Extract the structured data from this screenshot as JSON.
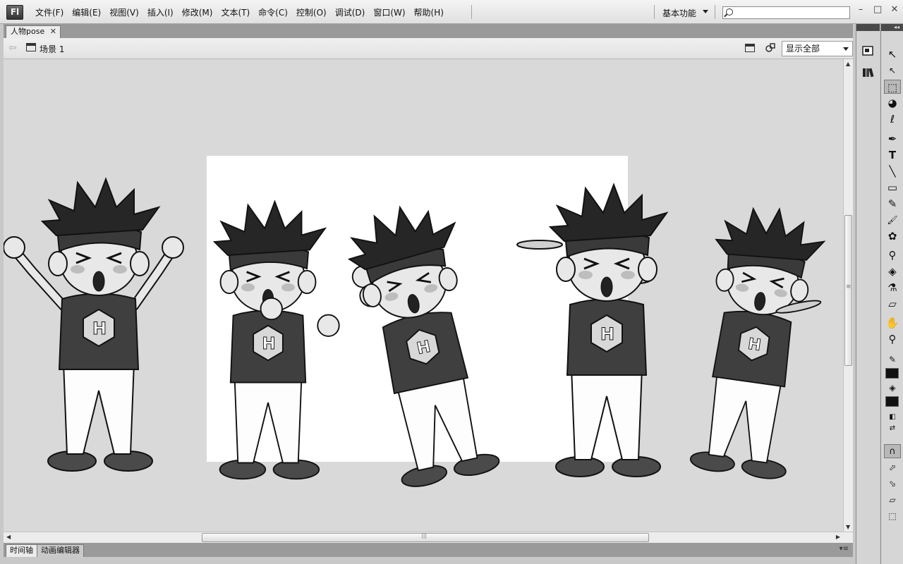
{
  "app": {
    "logo": "Fl"
  },
  "menu": [
    "文件(F)",
    "编辑(E)",
    "视图(V)",
    "插入(I)",
    "修改(M)",
    "文本(T)",
    "命令(C)",
    "控制(O)",
    "调试(D)",
    "窗口(W)",
    "帮助(H)"
  ],
  "workspace": {
    "label": "基本功能"
  },
  "search": {
    "value": ""
  },
  "window_controls": [
    "–",
    "□",
    "✕"
  ],
  "document": {
    "tab": "人物pose",
    "close": "✕"
  },
  "scene": {
    "label": "场景 1",
    "zoom": "显示全部"
  },
  "bottom_tabs": [
    "时间轴",
    "动画编辑器"
  ],
  "tools_header": "◂◂",
  "tools": [
    {
      "name": "selection-tool",
      "glyph": "↖"
    },
    {
      "name": "subselection-tool",
      "glyph": "↖"
    },
    {
      "name": "free-transform-tool",
      "glyph": "⬚"
    },
    {
      "name": "3d-rotation-tool",
      "glyph": "◕"
    },
    {
      "name": "lasso-tool",
      "glyph": "ℓ"
    },
    {
      "name": "pen-tool",
      "glyph": "✒"
    },
    {
      "name": "text-tool",
      "glyph": "T"
    },
    {
      "name": "line-tool",
      "glyph": "╲"
    },
    {
      "name": "rectangle-tool",
      "glyph": "▭"
    },
    {
      "name": "pencil-tool",
      "glyph": "✎"
    },
    {
      "name": "brush-tool",
      "glyph": "🖌"
    },
    {
      "name": "deco-tool",
      "glyph": "✿"
    },
    {
      "name": "bone-tool",
      "glyph": "⚲"
    },
    {
      "name": "paint-bucket-tool",
      "glyph": "◈"
    },
    {
      "name": "eyedropper-tool",
      "glyph": "⚗"
    },
    {
      "name": "eraser-tool",
      "glyph": "▱"
    },
    {
      "name": "hand-tool",
      "glyph": "✋"
    },
    {
      "name": "zoom-tool",
      "glyph": "⚲"
    }
  ]
}
